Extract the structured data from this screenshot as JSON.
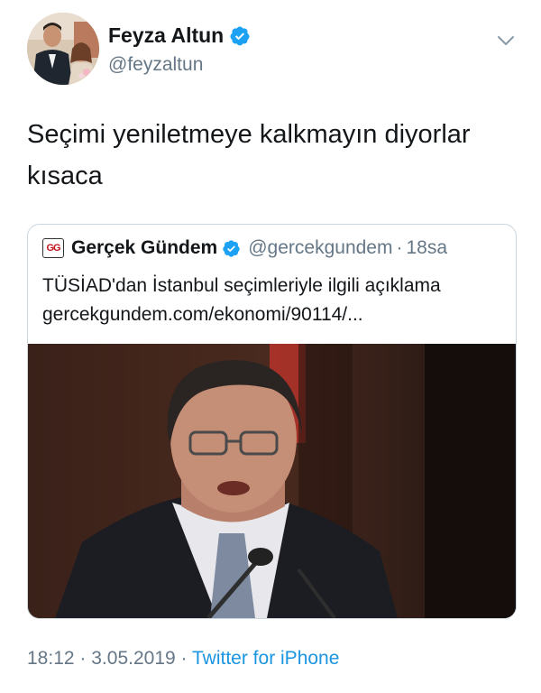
{
  "author": {
    "display_name": "Feyza Altun",
    "handle": "@feyzaltun",
    "verified": true
  },
  "tweet": {
    "line1": "Seçimi yeniletmeye kalkmayın diyorlar",
    "line2": "kısaca"
  },
  "quote": {
    "avatar_text": "GG",
    "display_name": "Gerçek Gündem",
    "handle": "@gercekgundem",
    "separator": "·",
    "time": "18sa",
    "text": "TÜSİAD'dan İstanbul seçimleriyle ilgili açıklama",
    "link": "gercekgundem.com/ekonomi/90114/..."
  },
  "footer": {
    "time": "18:12",
    "date": "3.05.2019",
    "separator": "·",
    "source": "Twitter for iPhone"
  },
  "colors": {
    "verified_blue": "#1da1f2",
    "link_blue": "#1b95e0",
    "secondary_text": "#657786",
    "border": "#ccd6dd"
  },
  "icons": {
    "verified": "verified-badge-icon",
    "menu": "chevron-down-icon"
  }
}
